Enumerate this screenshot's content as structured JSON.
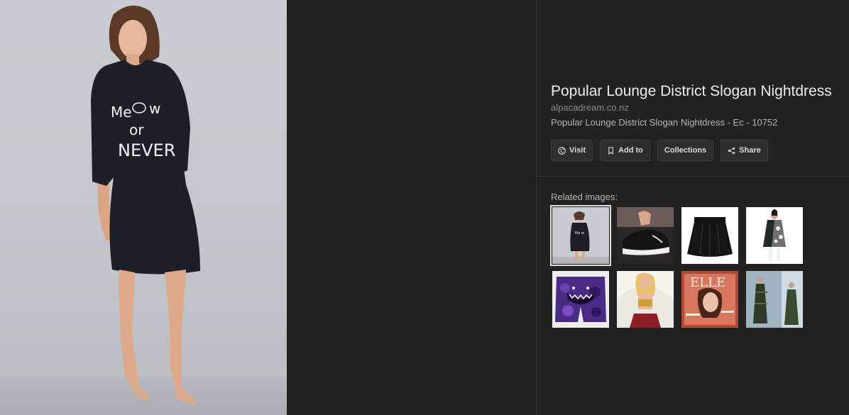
{
  "main_image": {
    "print_text": [
      "Me",
      "w",
      "or",
      "NEVER"
    ]
  },
  "info": {
    "title": "Popular Lounge District Slogan Nightdress",
    "domain": "alpacadream.co.nz",
    "description": "Popular Lounge District Slogan Nightdress - Ec - 10752"
  },
  "actions": {
    "visit": {
      "label": "Visit",
      "icon": "globe-icon"
    },
    "add_to": {
      "label": "Add to",
      "icon": "bookmark-icon"
    },
    "collections": {
      "label": "Collections"
    },
    "share": {
      "label": "Share",
      "icon": "share-icon"
    }
  },
  "related": {
    "label": "Related images:",
    "thumbnails": [
      "nightdress-woman-photo",
      "black-sneaker-photo",
      "black-skirt-photo",
      "patterned-tunic-photo",
      "purple-camo-shark-shorts-photo",
      "blonde-woman-gold-top-photo",
      "magazine-cover-photo",
      "green-dress-models-photo"
    ]
  },
  "colors": {
    "background": "#222222",
    "title": "#ececec",
    "button_bg": "#2d2d2d"
  }
}
